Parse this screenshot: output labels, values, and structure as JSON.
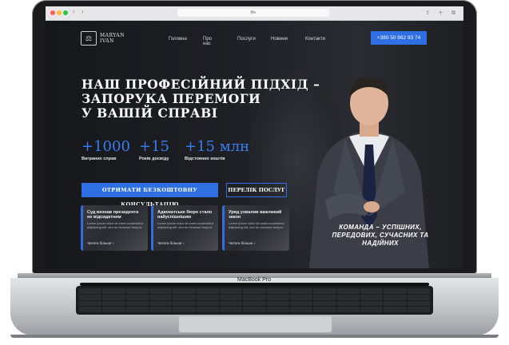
{
  "browser": {
    "url": "file",
    "nav_glyphs": "‹ ›",
    "right_glyphs": "⇪ ＋ ⧉"
  },
  "site": {
    "logo": {
      "line1": "MARYAN",
      "line2": "IVAN",
      "mark": "⚖"
    },
    "menu": [
      "Головна",
      "Про нас",
      "Послуги",
      "Новини",
      "Контакти"
    ],
    "phone": "+380 50 962 93 74",
    "headline": [
      "НАШ ПРОФЕСІЙНИЙ ПІДХІД –",
      "ЗАПОРУКА ПЕРЕМОГИ",
      "У ВАШІЙ СПРАВІ"
    ],
    "stats": [
      {
        "value": "+1000",
        "label": "Виграних справ"
      },
      {
        "value": "+15",
        "label": "Років досвіду"
      },
      {
        "value": "+15 млн",
        "label": "Відстояних коштів"
      }
    ],
    "cta_primary": "ОТРИМАТИ БЕЗКОШТОВНУ КОНСУЛЬТАЦІЮ",
    "cta_secondary": "ПЕРЕЛІК ПОСЛУГ",
    "cards": [
      {
        "title": "Суд визнав президента не відсидатним",
        "body": "Lorem ipsum dolor sit amet consectetur adipiscing elit, sed do eiusmod tempor.",
        "more": "Читати більше ›"
      },
      {
        "title": "Адвокатське бюро стало найуспішнішим",
        "body": "Lorem ipsum dolor sit amet consectetur adipiscing elit, sed do eiusmod tempor.",
        "more": "Читати більше ›"
      },
      {
        "title": "Уряд ухвалив важливий закон",
        "body": "Lorem ipsum dolor sit amet consectetur adipiscing elit, sed do eiusmod tempor.",
        "more": "Читати більше ›"
      }
    ],
    "tagline": "КОМАНДА – УСПІШНИХ, ПЕРЕДОВИХ, СУЧАСНИХ ТА НАДІЙНИХ"
  },
  "device": {
    "label": "MacBook Pro"
  },
  "colors": {
    "accent": "#2f6fe4",
    "background": "#16171b"
  }
}
